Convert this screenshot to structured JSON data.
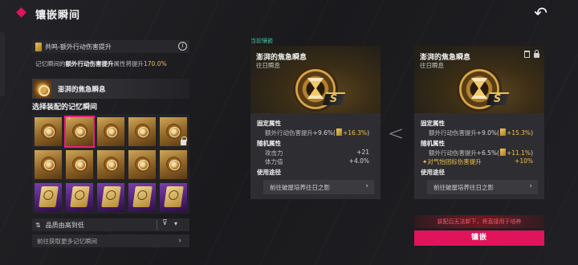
{
  "header": {
    "title": "镶嵌瞬间",
    "back_icon": "return-arrow-icon"
  },
  "left": {
    "ticket_label": "共鸣-额外行动伤害提升",
    "desc_prefix": "记忆瞬间的",
    "desc_attr": "额外行动伤害提升",
    "desc_mid": "属性将提升",
    "desc_value": "170.0%",
    "selected_name": "澎湃的焦急瞬息",
    "section_title": "选择装配的记忆瞬间",
    "sort_label": "品质由高到低",
    "get_more": "前往获取更多记忆瞬间"
  },
  "current_tag": "当前镶嵌",
  "panels": [
    {
      "title": "澎湃的焦急瞬息",
      "subtitle": "往日瞬息",
      "rank": "S",
      "fixed_header": "固定属性",
      "fixed_key": "额外行动伤害提升",
      "fixed_value": "+9.6%(",
      "fixed_bonus": "+16.3%",
      "fixed_close": ")",
      "random_header": "随机属性",
      "random": [
        {
          "k": "攻击力",
          "v": "+21"
        },
        {
          "k": "体力值",
          "v": "+4.0%"
        }
      ],
      "route_header": "使用途径",
      "route": "前往破屋培养往日之影"
    },
    {
      "title": "澎湃的焦急瞬息",
      "subtitle": "往日瞬息",
      "rank": "S",
      "fixed_header": "固定属性",
      "fixed_key": "额外行动伤害提升",
      "fixed_value": "+9.0%(",
      "fixed_bonus": "+15.3%",
      "fixed_close": ")",
      "random_header": "随机属性",
      "random": [
        {
          "k": "额外行动伤害提升",
          "v": "+6.5%(",
          "bonus": "+11.1%",
          "close": ")"
        },
        {
          "k": "✦对气怡团标伤害提升",
          "v": "+10%"
        }
      ],
      "route_header": "使用途径",
      "route": "前往破屋培养往日之影"
    }
  ],
  "compare_symbol": "<",
  "warning": "装配后无法卸下，将直接用于培养",
  "equip_label": "镶嵌"
}
